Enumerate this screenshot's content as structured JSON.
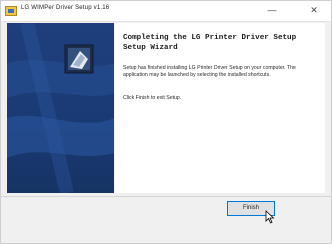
{
  "window": {
    "title": "LG WIMPer Driver Setup v1.16",
    "minimize_glyph": "—",
    "close_glyph": "✕"
  },
  "content": {
    "heading": "Completing the LG Printer Driver Setup Setup Wizard",
    "paragraph1": "Setup has finished installing LG Printer Driver Setup on your computer. The application may be launched by selecting the installed shortcuts.",
    "paragraph2": "Click Finish to exit Setup."
  },
  "footer": {
    "finish_label": "Finish"
  },
  "colors": {
    "side_panel": "#1e3f7c",
    "button_focus": "#0078d7"
  },
  "icons": {
    "app": "installer-icon",
    "wizard": "installer-box-icon"
  }
}
